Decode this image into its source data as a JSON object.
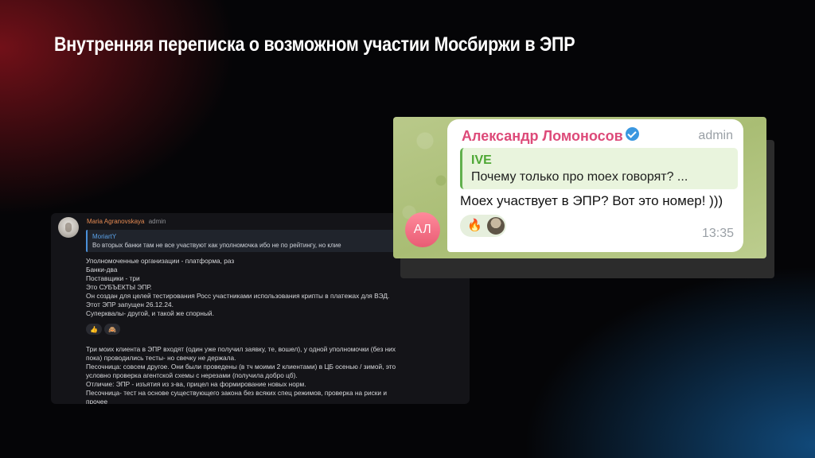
{
  "slide_title": "Внутренняя переписка о возможном участии Мосбиржи в ЭПР",
  "dark_chat": {
    "author": "Maria Agranovskaya",
    "role": "admin",
    "quote_author": "MoriartY",
    "quote_text": "Во вторых банки там не все участвуют как уполномочка ибо не по рейтингу, но клие",
    "message_lines": [
      "Уполномоченные организации - платформа, раз",
      "Банки-два",
      "Поставщики - три",
      "Это СУБЪЕКТЫ ЭПР.",
      "Он создан для целей тестирования Росс участниками использования крипты в платежах для ВЭД.",
      "Этот ЭПР запущен 26.12.24.",
      "Суперквалы- другой, и такой же спорный."
    ],
    "reactions": [
      "👍",
      "🙈"
    ],
    "message2_lines": [
      "Три моих клиента в ЭПР входят (один уже получил заявку, те, вошел), у одной уполномочки (без них",
      "пока) проводились тесты- но свечку не держала.",
      "Песочница: совсем другое. Они были проведены (в тч моими 2 клиентами) в ЦБ осенью / зимой, это",
      "условно проверка агентской схемы с нерезами (получила добро цб).",
      "Отличие: ЭПР - изъятия из з-ва, прицел на формирование новых норм.",
      "Песочница- тест на основе существующего закона без всяких спец режимов, проверка на риски и",
      "прочее"
    ]
  },
  "tg_chat": {
    "avatar_initials": "АЛ",
    "author": "Александр Ломоносов",
    "role": "admin",
    "quote_author": "IVE",
    "quote_text": "Почему только про moex говорят? ...",
    "message": "Моех участвует в ЭПР? Вот это номер! )))",
    "reaction": "🔥",
    "time": "13:35",
    "colors": {
      "name": "#dd4a79",
      "quote_accent": "#61b04d",
      "verified": "#3a97e0"
    }
  }
}
